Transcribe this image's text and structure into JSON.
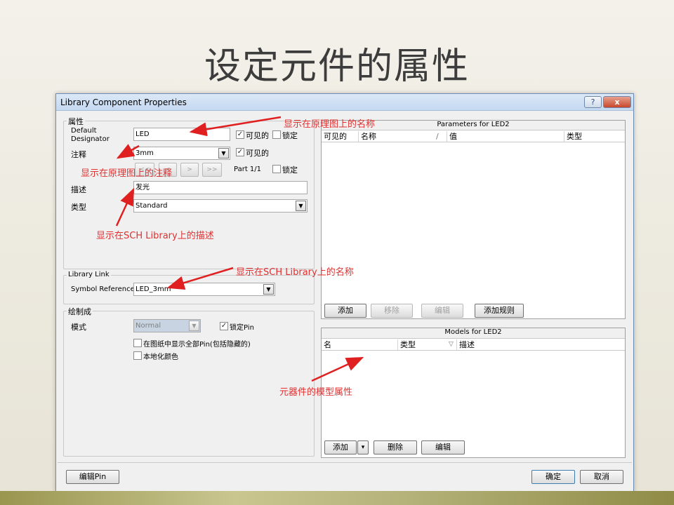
{
  "slide": {
    "title": "设定元件的属性"
  },
  "dialog": {
    "title": "Library Component Properties",
    "help_label": "?",
    "close_label": "x",
    "properties": {
      "group_label": "属性",
      "designator_label": "Default Designator",
      "designator_value": "LED",
      "visible_label": "可见的",
      "locked_label": "锁定",
      "comment_label": "注释",
      "comment_value": "3mm",
      "comment_visible_label": "可见的",
      "nav_first": "<<",
      "nav_prev": "<",
      "nav_next": ">",
      "nav_last": ">>",
      "part_label": "Part 1/1",
      "part_locked_label": "锁定",
      "description_label": "描述",
      "description_value": "发光",
      "type_label": "类型",
      "type_value": "Standard"
    },
    "library_link": {
      "group_label": "Library Link",
      "symbol_ref_label": "Symbol Reference",
      "symbol_ref_value": "LED_3mm"
    },
    "graphical": {
      "group_label": "绘制成",
      "mode_label": "模式",
      "mode_value": "Normal",
      "lock_pins_label": "锁定Pin",
      "show_all_pins_label": "在图纸中显示全部Pin(包括隐藏的)",
      "local_colors_label": "本地化颜色"
    },
    "parameters": {
      "title": "Parameters for LED2",
      "columns": [
        "可见的",
        "名称",
        "/",
        "值",
        "类型"
      ],
      "add": "添加",
      "remove": "移除",
      "edit": "编辑",
      "add_rule": "添加规则"
    },
    "models": {
      "title": "Models for LED2",
      "columns": [
        "名",
        "类型",
        "▽",
        "描述"
      ],
      "add": "添加",
      "add_arrow": "▾",
      "delete": "删除",
      "edit": "编辑"
    },
    "footer": {
      "edit_pins": "编辑Pin",
      "ok": "确定",
      "cancel": "取消"
    }
  },
  "annotations": {
    "designator_note": "显示在原理图上的名称",
    "comment_note": "显示在原理图上的注释",
    "description_note": "显示在SCH Library上的描述",
    "symbol_note": "显示在SCH Library上的名称",
    "models_note": "元器件的模型属性",
    "color": "#e03030"
  }
}
